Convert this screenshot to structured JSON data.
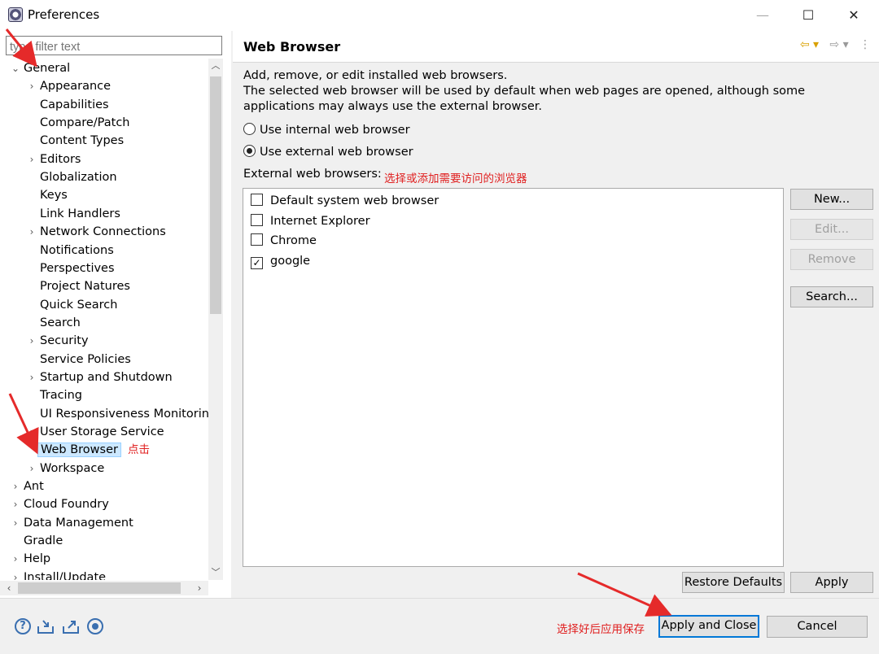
{
  "window": {
    "title": "Preferences",
    "minimize": "—",
    "maximize": "☐",
    "close": "✕"
  },
  "left": {
    "filter_placeholder": "type filter text",
    "tree": [
      {
        "label": "General",
        "level": 0,
        "twisty": "⌄",
        "name": "tree-item-general"
      },
      {
        "label": "Appearance",
        "level": 1,
        "twisty": "›",
        "name": "tree-item-appearance"
      },
      {
        "label": "Capabilities",
        "level": 1,
        "twisty": "",
        "name": "tree-item-capabilities"
      },
      {
        "label": "Compare/Patch",
        "level": 1,
        "twisty": "",
        "name": "tree-item-compare-patch"
      },
      {
        "label": "Content Types",
        "level": 1,
        "twisty": "",
        "name": "tree-item-content-types"
      },
      {
        "label": "Editors",
        "level": 1,
        "twisty": "›",
        "name": "tree-item-editors"
      },
      {
        "label": "Globalization",
        "level": 1,
        "twisty": "",
        "name": "tree-item-globalization"
      },
      {
        "label": "Keys",
        "level": 1,
        "twisty": "",
        "name": "tree-item-keys"
      },
      {
        "label": "Link Handlers",
        "level": 1,
        "twisty": "",
        "name": "tree-item-link-handlers"
      },
      {
        "label": "Network Connections",
        "level": 1,
        "twisty": "›",
        "name": "tree-item-network-connections"
      },
      {
        "label": "Notifications",
        "level": 1,
        "twisty": "",
        "name": "tree-item-notifications"
      },
      {
        "label": "Perspectives",
        "level": 1,
        "twisty": "",
        "name": "tree-item-perspectives"
      },
      {
        "label": "Project Natures",
        "level": 1,
        "twisty": "",
        "name": "tree-item-project-natures"
      },
      {
        "label": "Quick Search",
        "level": 1,
        "twisty": "",
        "name": "tree-item-quick-search"
      },
      {
        "label": "Search",
        "level": 1,
        "twisty": "",
        "name": "tree-item-search"
      },
      {
        "label": "Security",
        "level": 1,
        "twisty": "›",
        "name": "tree-item-security"
      },
      {
        "label": "Service Policies",
        "level": 1,
        "twisty": "",
        "name": "tree-item-service-policies"
      },
      {
        "label": "Startup and Shutdown",
        "level": 1,
        "twisty": "›",
        "name": "tree-item-startup-shutdown"
      },
      {
        "label": "Tracing",
        "level": 1,
        "twisty": "",
        "name": "tree-item-tracing"
      },
      {
        "label": "UI Responsiveness Monitorin",
        "level": 1,
        "twisty": "",
        "name": "tree-item-ui-responsiveness"
      },
      {
        "label": "User Storage Service",
        "level": 1,
        "twisty": "›",
        "name": "tree-item-user-storage"
      },
      {
        "label": "Web Browser",
        "level": 1,
        "twisty": "",
        "name": "tree-item-web-browser",
        "selected": true,
        "annotation": "点击"
      },
      {
        "label": "Workspace",
        "level": 1,
        "twisty": "›",
        "name": "tree-item-workspace"
      },
      {
        "label": "Ant",
        "level": 0,
        "twisty": "›",
        "name": "tree-item-ant"
      },
      {
        "label": "Cloud Foundry",
        "level": 0,
        "twisty": "›",
        "name": "tree-item-cloud-foundry"
      },
      {
        "label": "Data Management",
        "level": 0,
        "twisty": "›",
        "name": "tree-item-data-management"
      },
      {
        "label": "Gradle",
        "level": 0,
        "twisty": "",
        "name": "tree-item-gradle"
      },
      {
        "label": "Help",
        "level": 0,
        "twisty": "›",
        "name": "tree-item-help"
      },
      {
        "label": "Install/Update",
        "level": 0,
        "twisty": "›",
        "name": "tree-item-install-update"
      }
    ]
  },
  "page": {
    "title": "Web Browser",
    "nav": {
      "back": "⇦ ▾",
      "forward": "⇨ ▾",
      "menu": "⋮"
    },
    "desc_line1": "Add, remove, or edit installed web browsers.",
    "desc_line2": "The selected web browser will be used by default when web pages are opened, although some applications may always use the external browser.",
    "radio_internal": "Use internal web browser",
    "radio_external": "Use external web browser",
    "external_label": "External web browsers:",
    "external_annotation": "选择或添加需要访问的浏览器",
    "browsers": [
      {
        "label": "Default system web browser",
        "checked": false
      },
      {
        "label": "Internet Explorer",
        "checked": false
      },
      {
        "label": "Chrome",
        "checked": false
      },
      {
        "label": "google",
        "checked": true
      }
    ],
    "buttons": {
      "new": "New...",
      "edit": "Edit...",
      "remove": "Remove",
      "search": "Search..."
    },
    "restore_defaults": "Restore Defaults",
    "apply": "Apply"
  },
  "bottom": {
    "annotation": "选择好后应用保存",
    "apply_close": "Apply and Close",
    "cancel": "Cancel",
    "icons": [
      "help-icon",
      "import-icon",
      "export-icon",
      "record-icon"
    ]
  },
  "colors": {
    "annotation": "#e02020",
    "selection": "#cce8ff",
    "default_button_border": "#0078d7"
  }
}
